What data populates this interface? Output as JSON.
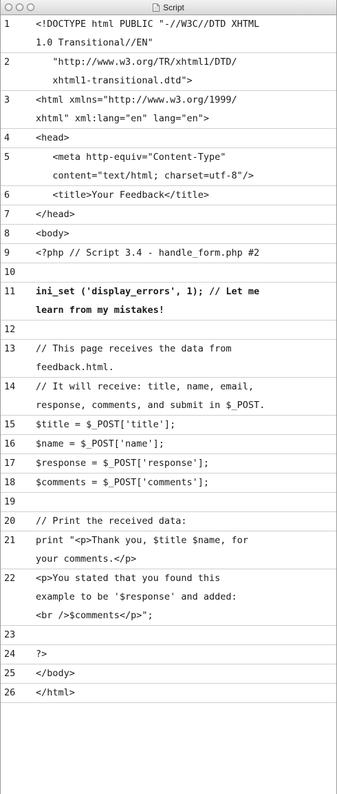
{
  "window": {
    "title": "Script",
    "buttons": [
      "close",
      "minimize",
      "zoom"
    ]
  },
  "lines": [
    {
      "num": "1",
      "bold": false,
      "text": [
        "<!DOCTYPE html PUBLIC \"-//W3C//DTD XHTML",
        "1.0 Transitional//EN\""
      ]
    },
    {
      "num": "2",
      "bold": false,
      "text": [
        "   \"http://www.w3.org/TR/xhtml1/DTD/",
        "   xhtml1-transitional.dtd\">"
      ]
    },
    {
      "num": "3",
      "bold": false,
      "text": [
        "<html xmlns=\"http://www.w3.org/1999/",
        "xhtml\" xml:lang=\"en\" lang=\"en\">"
      ]
    },
    {
      "num": "4",
      "bold": false,
      "text": [
        "<head>"
      ]
    },
    {
      "num": "5",
      "bold": false,
      "text": [
        "   <meta http-equiv=\"Content-Type\"",
        "   content=\"text/html; charset=utf-8\"/>"
      ]
    },
    {
      "num": "6",
      "bold": false,
      "text": [
        "   <title>Your Feedback</title>"
      ]
    },
    {
      "num": "7",
      "bold": false,
      "text": [
        "</head>"
      ]
    },
    {
      "num": "8",
      "bold": false,
      "text": [
        "<body>"
      ]
    },
    {
      "num": "9",
      "bold": false,
      "text": [
        "<?php // Script 3.4 - handle_form.php #2"
      ]
    },
    {
      "num": "10",
      "bold": false,
      "text": [
        ""
      ]
    },
    {
      "num": "11",
      "bold": true,
      "text": [
        "ini_set ('display_errors', 1); // Let me",
        "learn from my mistakes!"
      ]
    },
    {
      "num": "12",
      "bold": false,
      "text": [
        ""
      ]
    },
    {
      "num": "13",
      "bold": false,
      "text": [
        "// This page receives the data from",
        "feedback.html."
      ]
    },
    {
      "num": "14",
      "bold": false,
      "text": [
        "// It will receive: title, name, email,",
        "response, comments, and submit in $_POST."
      ]
    },
    {
      "num": "15",
      "bold": false,
      "text": [
        "$title = $_POST['title'];"
      ]
    },
    {
      "num": "16",
      "bold": false,
      "text": [
        "$name = $_POST['name'];"
      ]
    },
    {
      "num": "17",
      "bold": false,
      "text": [
        "$response = $_POST['response'];"
      ]
    },
    {
      "num": "18",
      "bold": false,
      "text": [
        "$comments = $_POST['comments'];"
      ]
    },
    {
      "num": "19",
      "bold": false,
      "text": [
        ""
      ]
    },
    {
      "num": "20",
      "bold": false,
      "text": [
        "// Print the received data:"
      ]
    },
    {
      "num": "21",
      "bold": false,
      "text": [
        "print \"<p>Thank you, $title $name, for",
        "your comments.</p>"
      ]
    },
    {
      "num": "22",
      "bold": false,
      "text": [
        "<p>You stated that you found this",
        "example to be '$response' and added:",
        "<br />$comments</p>\";"
      ]
    },
    {
      "num": "23",
      "bold": false,
      "text": [
        ""
      ]
    },
    {
      "num": "24",
      "bold": false,
      "text": [
        "?>"
      ]
    },
    {
      "num": "25",
      "bold": false,
      "text": [
        "</body>"
      ]
    },
    {
      "num": "26",
      "bold": false,
      "text": [
        "</html>"
      ]
    }
  ]
}
